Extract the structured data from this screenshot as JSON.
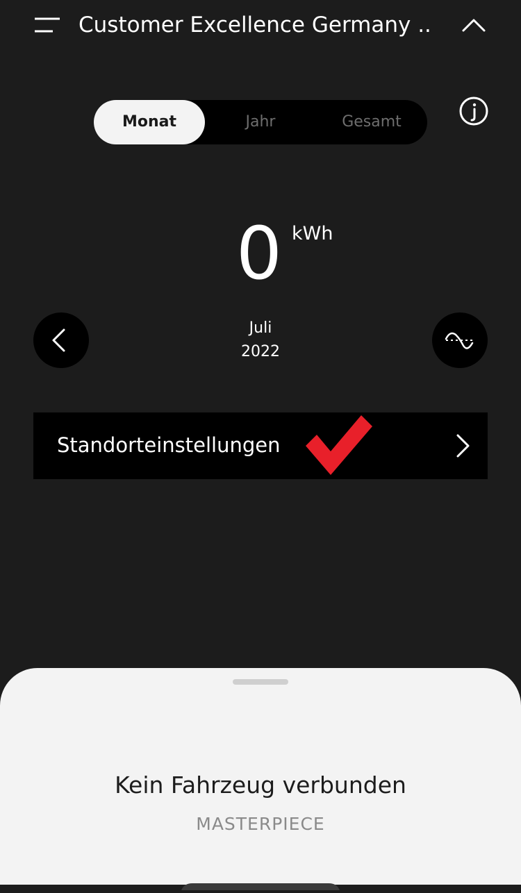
{
  "header": {
    "title": "Customer Excellence Germany ..."
  },
  "period_selector": {
    "tabs": [
      {
        "label": "Monat",
        "active": true
      },
      {
        "label": "Jahr",
        "active": false
      },
      {
        "label": "Gesamt",
        "active": false
      }
    ]
  },
  "energy": {
    "value": "0",
    "unit": "kWh"
  },
  "period": {
    "month": "Juli",
    "year": "2022"
  },
  "settings": {
    "label": "Standorteinstellungen"
  },
  "sheet": {
    "title": "Kein Fahrzeug verbunden",
    "subtitle": "MASTERPIECE"
  },
  "icons": {
    "menu": "menu-icon",
    "collapse": "chevron-up-icon",
    "info": "info-icon",
    "previous": "chevron-left-icon",
    "compare": "compare-curve-icon",
    "settings_arrow": "chevron-right-icon",
    "annotation": "checkmark-icon"
  },
  "colors": {
    "background": "#1c1c1c",
    "surface": "#000000",
    "active_tab": "#f3f3f3",
    "inactive_tab_text": "#6e6e6e",
    "checkmark": "#e8202a",
    "sheet": "#f3f3f3"
  }
}
